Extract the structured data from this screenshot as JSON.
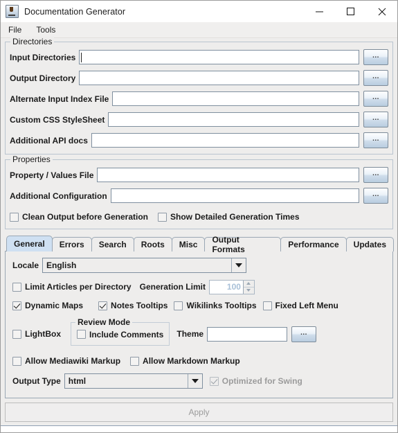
{
  "window": {
    "title": "Documentation Generator",
    "icon": "java-coffee-cup-icon",
    "controls": {
      "minimize": "minimize-icon",
      "maximize": "maximize-icon",
      "close": "close-icon"
    }
  },
  "menubar": {
    "items": [
      {
        "label": "File"
      },
      {
        "label": "Tools"
      }
    ]
  },
  "directories": {
    "title": "Directories",
    "rows": [
      {
        "label": "Input Directories",
        "value": "",
        "focused": true,
        "browse": "..."
      },
      {
        "label": "Output Directory",
        "value": "",
        "focused": false,
        "browse": "..."
      },
      {
        "label": "Alternate Input Index File",
        "value": "",
        "focused": false,
        "browse": "..."
      },
      {
        "label": "Custom CSS StyleSheet",
        "value": "",
        "focused": false,
        "browse": "..."
      },
      {
        "label": "Additional API docs",
        "value": "",
        "focused": false,
        "browse": "..."
      }
    ]
  },
  "properties": {
    "title": "Properties",
    "rows": [
      {
        "label": "Property / Values File",
        "value": "",
        "browse": "..."
      },
      {
        "label": "Additional Configuration",
        "value": "",
        "browse": "..."
      }
    ],
    "checkboxes": [
      {
        "label": "Clean Output before Generation",
        "checked": false
      },
      {
        "label": "Show Detailed Generation Times",
        "checked": false
      }
    ]
  },
  "tabs": {
    "items": [
      {
        "label": "General",
        "active": true
      },
      {
        "label": "Errors",
        "active": false
      },
      {
        "label": "Search",
        "active": false
      },
      {
        "label": "Roots",
        "active": false
      },
      {
        "label": "Misc",
        "active": false
      },
      {
        "label": "Output Formats",
        "active": false
      },
      {
        "label": "Performance",
        "active": false
      },
      {
        "label": "Updates",
        "active": false
      }
    ]
  },
  "general": {
    "locale": {
      "label": "Locale",
      "value": "English"
    },
    "limit_articles": {
      "label": "Limit Articles per Directory",
      "checked": false
    },
    "generation_limit": {
      "label": "Generation Limit",
      "value": "100",
      "disabled": true
    },
    "toggles": [
      {
        "label": "Dynamic Maps",
        "checked": true
      },
      {
        "label": "Notes Tooltips",
        "checked": true
      },
      {
        "label": "Wikilinks Tooltips",
        "checked": false
      },
      {
        "label": "Fixed Left Menu",
        "checked": false
      }
    ],
    "lightbox": {
      "label": "LightBox",
      "checked": false
    },
    "review_mode": {
      "title": "Review Mode",
      "include_comments": {
        "label": "Include Comments",
        "checked": false
      }
    },
    "theme": {
      "label": "Theme",
      "value": "",
      "browse": "..."
    },
    "markup": [
      {
        "label": "Allow Mediawiki Markup",
        "checked": false
      },
      {
        "label": "Allow Markdown Markup",
        "checked": false
      }
    ],
    "output_type": {
      "label": "Output Type",
      "value": "html"
    },
    "optimized_for_swing": {
      "label": "Optimized for Swing",
      "checked": true,
      "disabled": true
    }
  },
  "apply": {
    "label": "Apply",
    "disabled": true
  }
}
